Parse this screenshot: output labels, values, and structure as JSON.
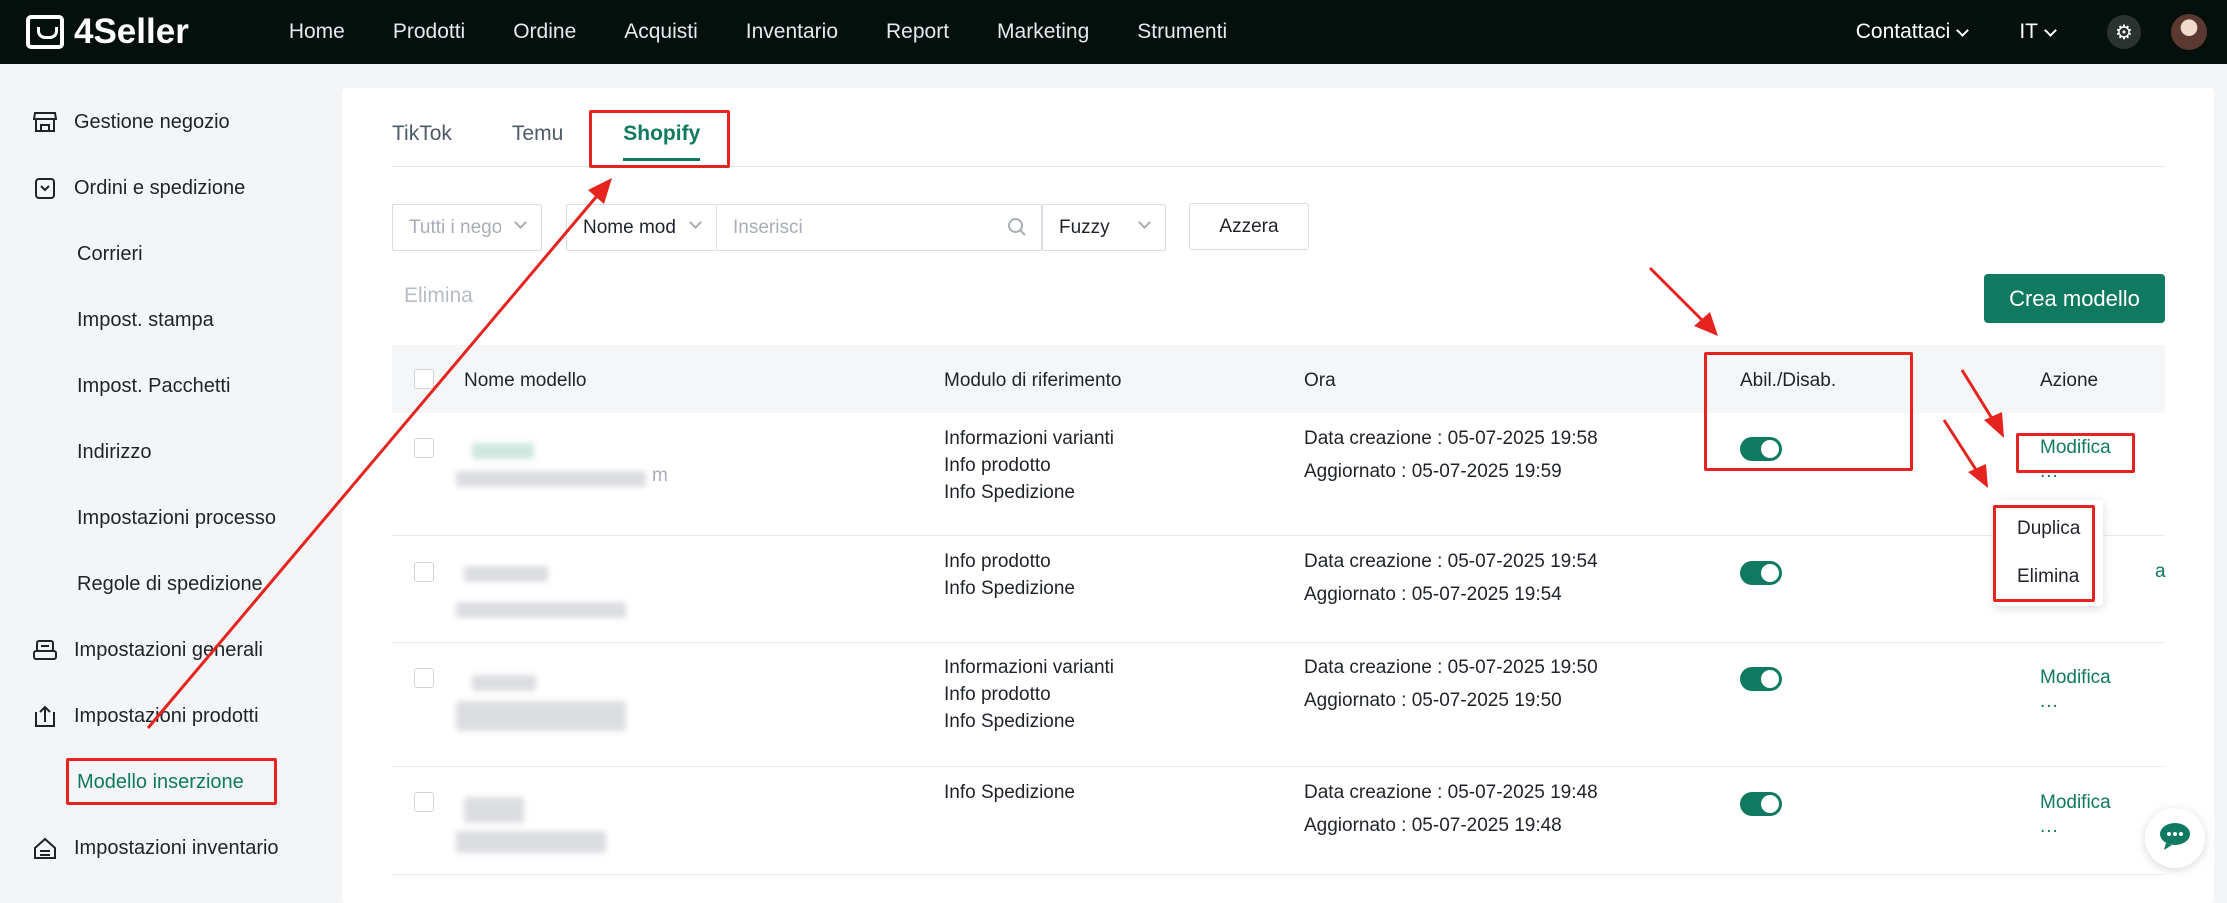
{
  "app": {
    "name": "4Seller"
  },
  "nav": [
    "Home",
    "Prodotti",
    "Ordine",
    "Acquisti",
    "Inventario",
    "Report",
    "Marketing",
    "Strumenti"
  ],
  "header": {
    "contact": "Contattaci",
    "language": "IT"
  },
  "sidebar": {
    "gestione": "Gestione negozio",
    "ordini": "Ordini e spedizione",
    "subs1": [
      "Corrieri",
      "Impost. stampa",
      "Impost. Pacchetti",
      "Indirizzo",
      "Impostazioni processo",
      "Regole di spedizione"
    ],
    "generali": "Impostazioni generali",
    "prodotti": "Impostazioni prodotti",
    "modello": "Modello inserzione",
    "inventario": "Impostazioni inventario"
  },
  "tabs": [
    "TikTok",
    "Temu",
    "Shopify"
  ],
  "filters": {
    "store_placeholder": "Tutti i negozi",
    "field_select": "Nome modello",
    "search_placeholder": "Inserisci",
    "match_mode": "Fuzzy",
    "reset_label": "Azzera"
  },
  "toolbar": {
    "delete_label": "Elimina",
    "create_label": "Crea modello"
  },
  "table": {
    "columns": [
      "Nome modello",
      "Modulo di riferimento",
      "Ora",
      "Abil./Disab.",
      "Azione"
    ],
    "rows": [
      {
        "modules": [
          "Informazioni varianti",
          "Info prodotto",
          "Info Spedizione"
        ],
        "created": "Data creazione : 05-07-2025 19:58",
        "updated": "Aggiornato : 05-07-2025 19:59",
        "enabled": true,
        "name_tail": "m"
      },
      {
        "modules": [
          "Info prodotto",
          "Info Spedizione"
        ],
        "created": "Data creazione : 05-07-2025 19:54",
        "updated": "Aggiornato : 05-07-2025 19:54",
        "enabled": true,
        "name_tail": ""
      },
      {
        "modules": [
          "Informazioni varianti",
          "Info prodotto",
          "Info Spedizione"
        ],
        "created": "Data creazione : 05-07-2025 19:50",
        "updated": "Aggiornato : 05-07-2025 19:50",
        "enabled": true,
        "name_tail": ""
      },
      {
        "modules": [
          "Info Spedizione"
        ],
        "created": "Data creazione : 05-07-2025 19:48",
        "updated": "Aggiornato : 05-07-2025 19:48",
        "enabled": true,
        "name_tail": ""
      }
    ],
    "action_edit": "Modifica",
    "action_more": "...",
    "partial_edit": "a"
  },
  "more_menu": {
    "duplicate": "Duplica",
    "delete": "Elimina"
  },
  "colors": {
    "accent": "#0f7a5f",
    "annotation": "#e52420",
    "topbar": "#050f0c"
  }
}
